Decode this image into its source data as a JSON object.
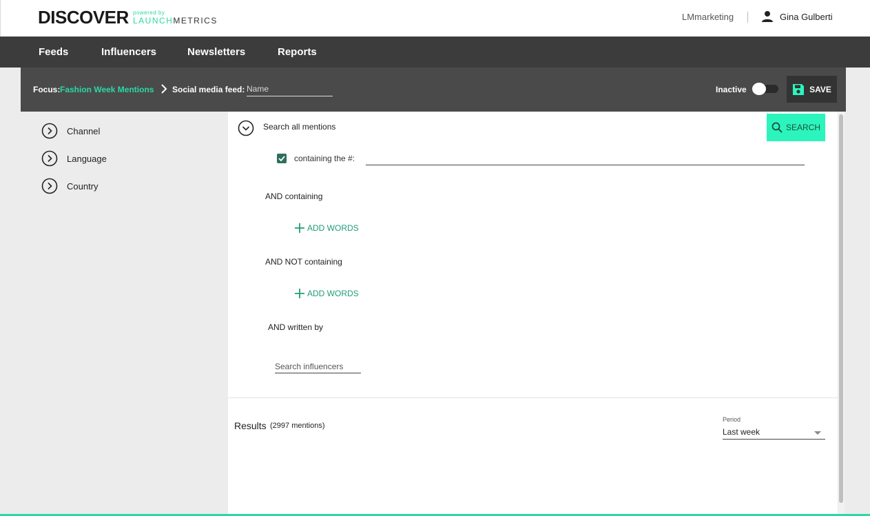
{
  "header": {
    "brand_main": "DISCOVER",
    "brand_powered": "powered by",
    "brand_launch": "LAUNCH",
    "brand_metrics": "METRICS",
    "account": "LMmarketing",
    "user_name": "Gina Gulberti",
    "user_icon": "person-icon"
  },
  "nav": {
    "items": [
      {
        "label": "Feeds"
      },
      {
        "label": "Influencers"
      },
      {
        "label": "Newsletters"
      },
      {
        "label": "Reports"
      }
    ]
  },
  "focus_bar": {
    "focus_label": "Focus:",
    "focus_value": "Fashion Week Mentions",
    "feed_label": "Social media feed:",
    "feed_placeholder": "Name",
    "feed_value": "",
    "status_label": "Inactive",
    "toggle_on": false,
    "save_label": "SAVE",
    "save_icon": "floppy-disk-icon"
  },
  "filters": {
    "items": [
      {
        "label": "Channel",
        "icon": "chevron-right-circle-icon"
      },
      {
        "label": "Language",
        "icon": "chevron-right-circle-icon"
      },
      {
        "label": "Country",
        "icon": "chevron-right-circle-icon"
      }
    ]
  },
  "search_panel": {
    "title": "Search all mentions",
    "search_button_label": "SEARCH",
    "hashtag_checked": true,
    "hashtag_label": "containing the #:",
    "hashtag_value": "",
    "and_containing_label": "AND containing",
    "add_words_label_1": "ADD WORDS",
    "and_not_containing_label": "AND NOT containing",
    "add_words_label_2": "ADD WORDS",
    "written_by_label": "AND written by",
    "influencer_placeholder": "Search influencers"
  },
  "results": {
    "label": "Results",
    "count_text": "(2997 mentions)",
    "period_label": "Period",
    "period_value": "Last week"
  },
  "colors": {
    "accent": "#2bd8a6",
    "search_button": "#2bf5bc",
    "nav_bg": "#3c3c3c",
    "focus_bar_bg": "#4a4a4a",
    "checkbox": "#2e6e5c"
  }
}
